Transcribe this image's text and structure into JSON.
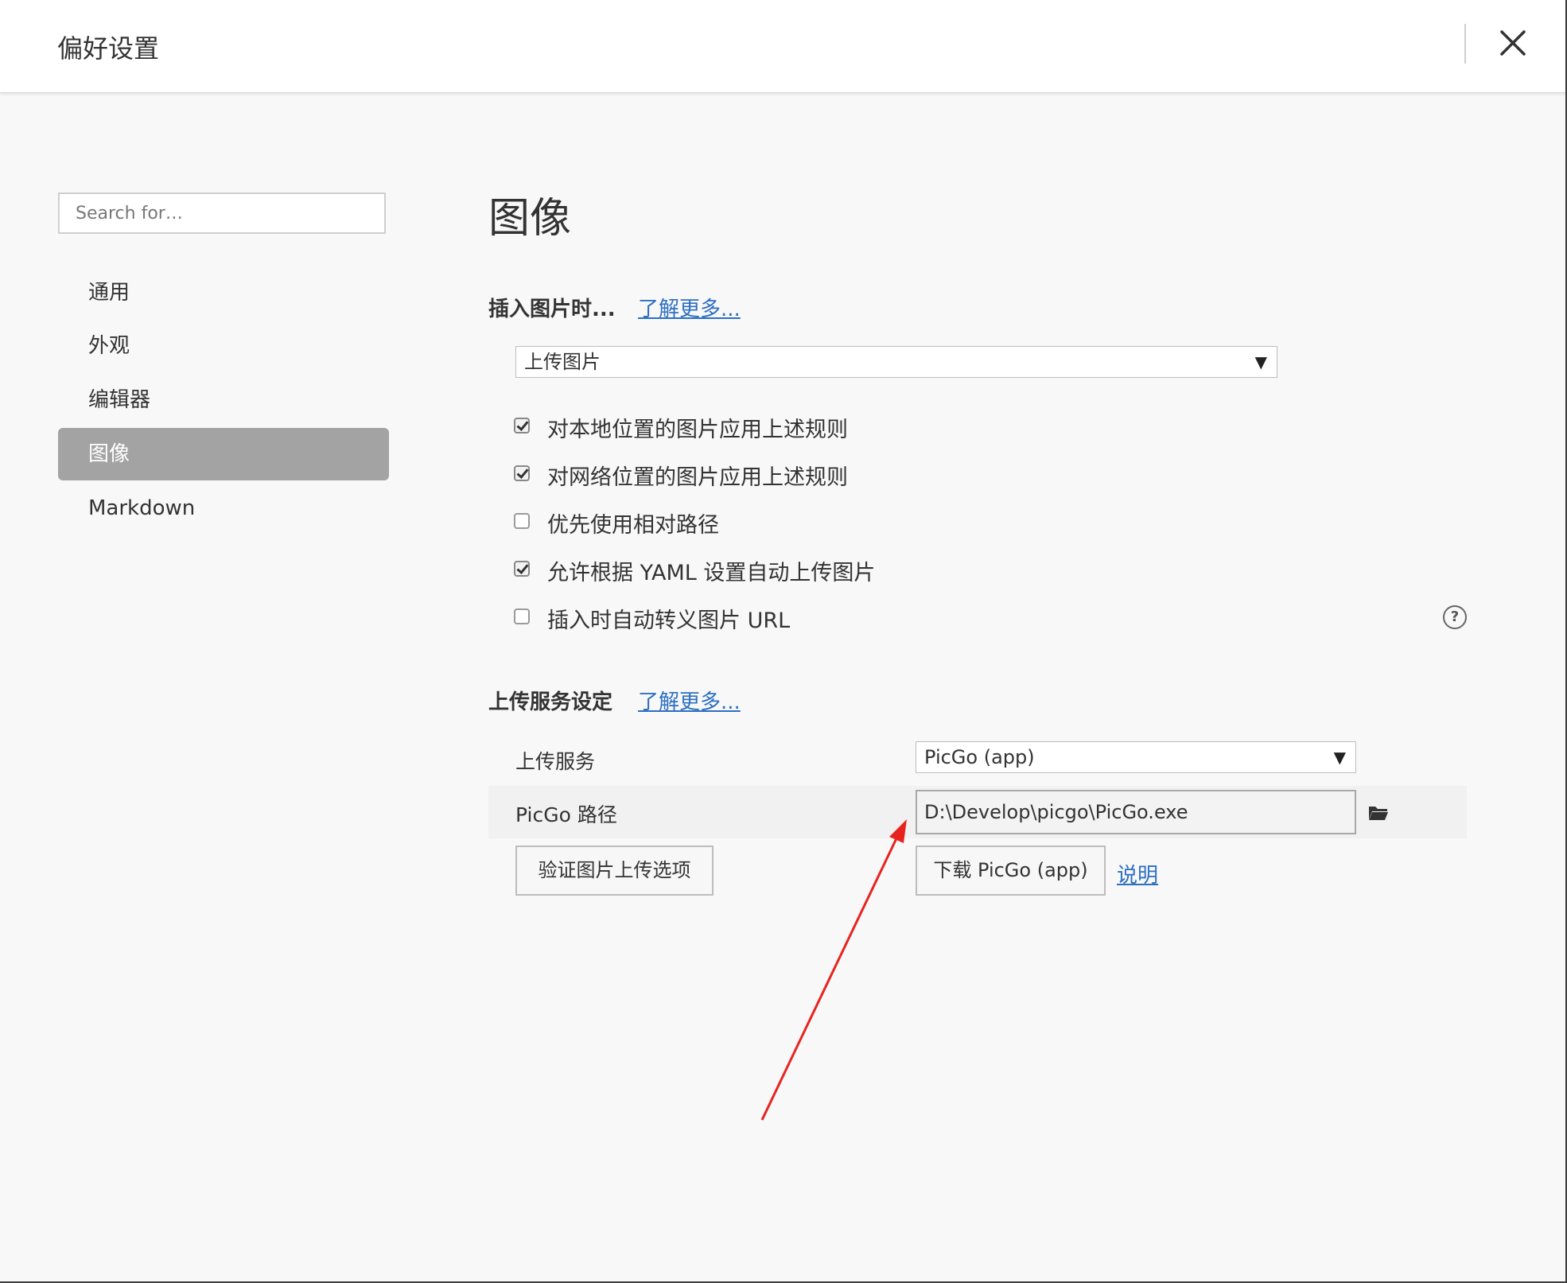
{
  "window": {
    "title": "偏好设置"
  },
  "sidebar": {
    "search_placeholder": "Search for…",
    "items": [
      {
        "label": "通用",
        "active": false
      },
      {
        "label": "外观",
        "active": false
      },
      {
        "label": "编辑器",
        "active": false
      },
      {
        "label": "图像",
        "active": true
      },
      {
        "label": "Markdown",
        "active": false
      }
    ]
  },
  "main": {
    "heading": "图像",
    "insert_section": {
      "title": "插入图片时...",
      "learn_more": "了解更多...",
      "action_selected": "上传图片",
      "options": [
        {
          "label": "对本地位置的图片应用上述规则",
          "checked": true
        },
        {
          "label": "对网络位置的图片应用上述规则",
          "checked": true
        },
        {
          "label": "优先使用相对路径",
          "checked": false
        },
        {
          "label": "允许根据 YAML 设置自动上传图片",
          "checked": true
        },
        {
          "label": "插入时自动转义图片 URL",
          "checked": false
        }
      ]
    },
    "upload_section": {
      "title": "上传服务设定",
      "learn_more": "了解更多...",
      "service_label": "上传服务",
      "service_selected": "PicGo (app)",
      "path_label": "PicGo 路径",
      "path_value": "D:\\Develop\\picgo\\PicGo.exe",
      "verify_button": "验证图片上传选项",
      "download_button": "下载 PicGo (app)",
      "explain_link": "说明"
    }
  },
  "colors": {
    "link": "#2d6fc3",
    "active_nav_bg": "#a3a3a3",
    "annotation_arrow": "#e8231f"
  },
  "icons": [
    "close-icon",
    "help-icon",
    "folder-icon",
    "dropdown-arrow-icon"
  ]
}
